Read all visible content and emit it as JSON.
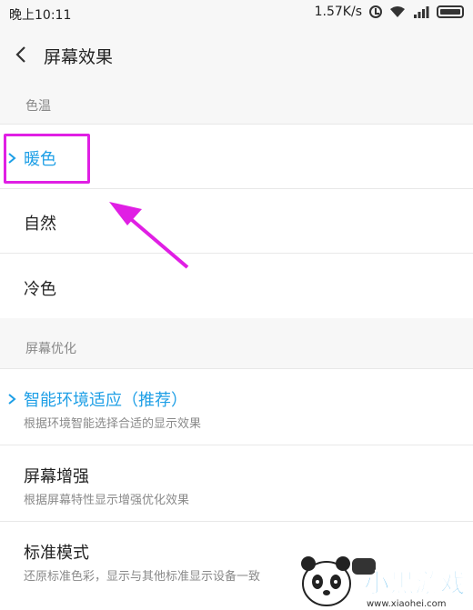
{
  "status_bar": {
    "time": "晚上10:11",
    "speed": "1.57K/s",
    "icons": [
      "alarm-icon",
      "wifi-icon",
      "signal-icon",
      "battery-icon"
    ]
  },
  "header": {
    "title": "屏幕效果",
    "back_icon": "chevron-left-icon"
  },
  "sections": {
    "color_temp": {
      "label": "色温",
      "items": [
        {
          "title": "暖色",
          "selected": true
        },
        {
          "title": "自然",
          "selected": false
        },
        {
          "title": "冷色",
          "selected": false
        }
      ]
    },
    "optimize": {
      "label": "屏幕优化",
      "items": [
        {
          "title": "智能环境适应（推荐）",
          "subtitle": "根据环境智能选择合适的显示效果",
          "selected": true
        },
        {
          "title": "屏幕增强",
          "subtitle": "根据屏幕特性显示增强优化效果",
          "selected": false
        },
        {
          "title": "标准模式",
          "subtitle": "还原标准色彩，显示与其他标准显示设备一致",
          "selected": false
        }
      ]
    }
  },
  "colors": {
    "accent": "#1e9fe6",
    "annotation": "#e01fe4",
    "background": "#f7f7f7"
  },
  "watermark": {
    "brand": "小黑游戏",
    "url": "www.xiaohei.com"
  }
}
